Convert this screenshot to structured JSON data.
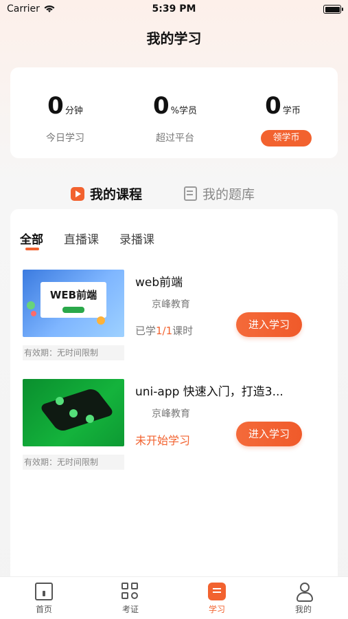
{
  "status_bar": {
    "carrier": "Carrier",
    "time": "5:39 PM"
  },
  "header": {
    "title": "我的学习"
  },
  "stats": [
    {
      "value": "0",
      "unit": "分钟",
      "label": "今日学习"
    },
    {
      "value": "0",
      "unit": "%学员",
      "label": "超过平台"
    },
    {
      "value": "0",
      "unit": "学币",
      "action": "领学币"
    }
  ],
  "main_tabs": [
    {
      "label": "我的课程",
      "icon": "play-square-icon",
      "active": true
    },
    {
      "label": "我的题库",
      "icon": "question-bank-icon",
      "active": false
    }
  ],
  "sub_tabs": [
    {
      "label": "全部",
      "active": true
    },
    {
      "label": "直播课",
      "active": false
    },
    {
      "label": "录播课",
      "active": false
    }
  ],
  "courses": [
    {
      "title": "web前端",
      "org": "京峰教育",
      "progress_prefix": "已学",
      "progress_value": "1/1",
      "progress_suffix": "课时",
      "thumb_text": "WEB前端",
      "validity": "有效期：无时间限制",
      "button": "进入学习"
    },
    {
      "title": "uni-app 快速入门，打造3...",
      "org": "京峰教育",
      "status": "未开始学习",
      "validity": "有效期：无时间限制",
      "button": "进入学习"
    }
  ],
  "tabbar": [
    {
      "label": "首页",
      "icon": "home-icon"
    },
    {
      "label": "考证",
      "icon": "grid-search-icon"
    },
    {
      "label": "学习",
      "icon": "study-icon",
      "active": true
    },
    {
      "label": "我的",
      "icon": "user-icon"
    }
  ],
  "colors": {
    "accent": "#f2622f"
  }
}
